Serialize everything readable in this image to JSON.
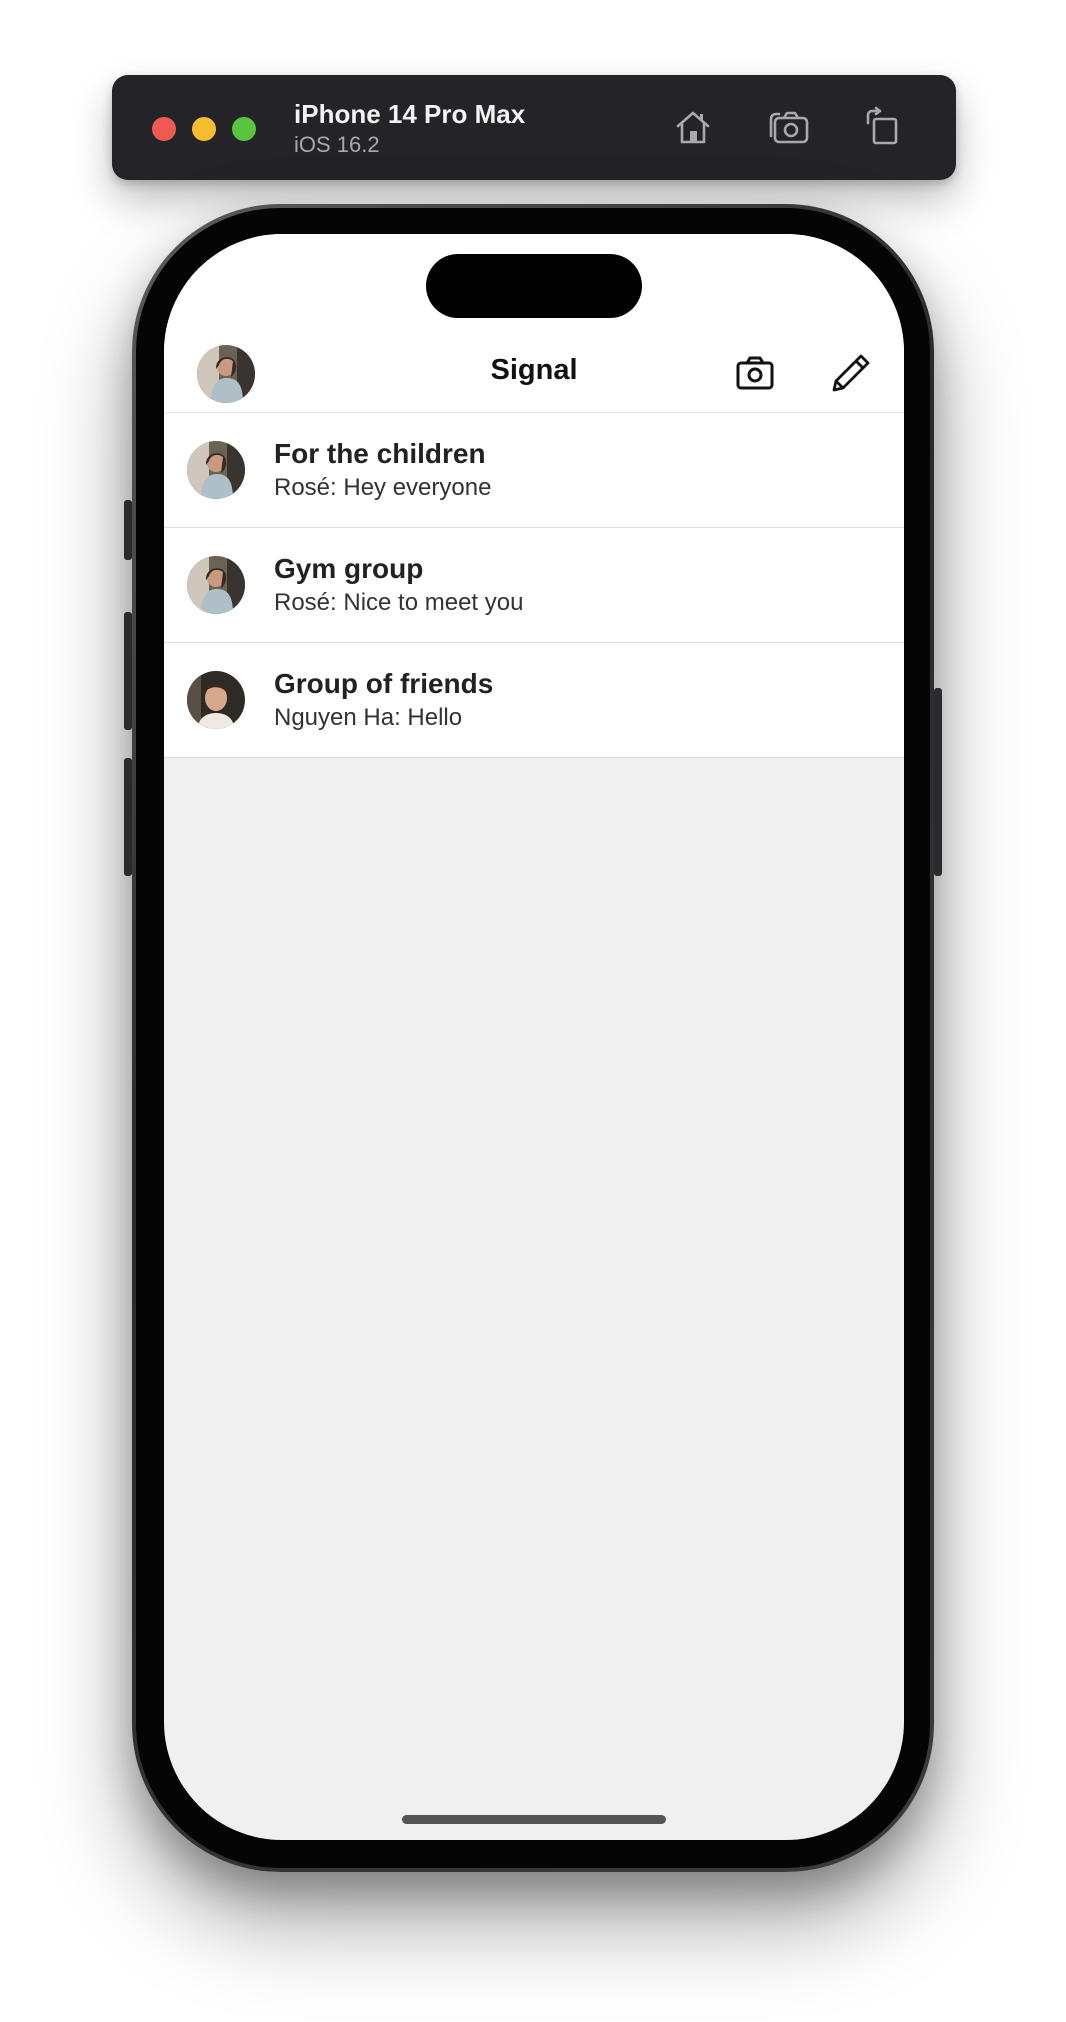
{
  "simulator": {
    "device_name": "iPhone 14 Pro Max",
    "os_version": "iOS 16.2",
    "icons": [
      "home-icon",
      "screenshot-icon",
      "rotate-icon"
    ]
  },
  "app": {
    "title": "Signal",
    "header_icons": [
      "camera-icon",
      "compose-pencil-icon"
    ],
    "conversations": [
      {
        "name": "For the children",
        "snippet": "Rosé: Hey everyone",
        "avatar": "woman-photo"
      },
      {
        "name": "Gym group",
        "snippet": "Rosé: Nice to meet you",
        "avatar": "woman-photo"
      },
      {
        "name": "Group of friends",
        "snippet": "Nguyen Ha: Hello",
        "avatar": "man-photo"
      }
    ]
  },
  "colors": {
    "toolbar_bg": "#242327",
    "screen_bg": "#f0f0f0",
    "row_bg": "#ffffff"
  }
}
